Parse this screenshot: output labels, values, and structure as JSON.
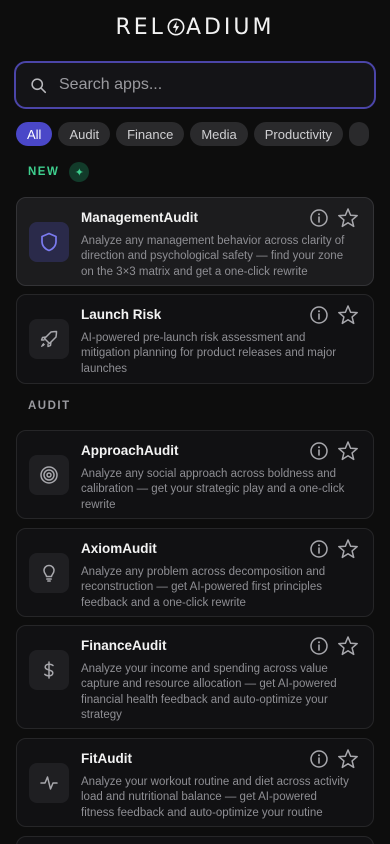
{
  "brand": {
    "logo_left": "REL",
    "logo_right": "ADIUM"
  },
  "search": {
    "placeholder": "Search apps..."
  },
  "chips": [
    "All",
    "Audit",
    "Finance",
    "Media",
    "Productivity"
  ],
  "sections": {
    "new_label": "NEW",
    "new_badge": "✦",
    "audit_label": "AUDIT"
  },
  "cards": [
    {
      "title": "ManagementAudit",
      "icon": "shield-icon",
      "desc": "Analyze any management behavior across clarity of direction and psychological safety — find your zone on the 3×3 matrix and get a one-click rewrite"
    },
    {
      "title": "Launch Risk",
      "icon": "rocket-icon",
      "desc": "AI-powered pre-launch risk assessment and mitigation planning for product releases and major launches"
    },
    {
      "title": "ApproachAudit",
      "icon": "target-icon",
      "desc": "Analyze any social approach across boldness and calibration — get your strategic play and a one-click rewrite"
    },
    {
      "title": "AxiomAudit",
      "icon": "lightbulb-icon",
      "desc": "Analyze any problem across decomposition and reconstruction — get AI-powered first principles feedback and a one-click rewrite"
    },
    {
      "title": "FinanceAudit",
      "icon": "dollar-icon",
      "desc": "Analyze your income and spending across value capture and resource allocation — get AI-powered financial health feedback and auto-optimize your strategy"
    },
    {
      "title": "FitAudit",
      "icon": "activity-icon",
      "desc": "Analyze your workout routine and diet across activity load and nutritional balance — get AI-powered fitness feedback and auto-optimize your routine"
    }
  ],
  "colors": {
    "accent": "#4a47c8",
    "new_green": "#3ecf8e",
    "background": "#0d0d0d"
  }
}
